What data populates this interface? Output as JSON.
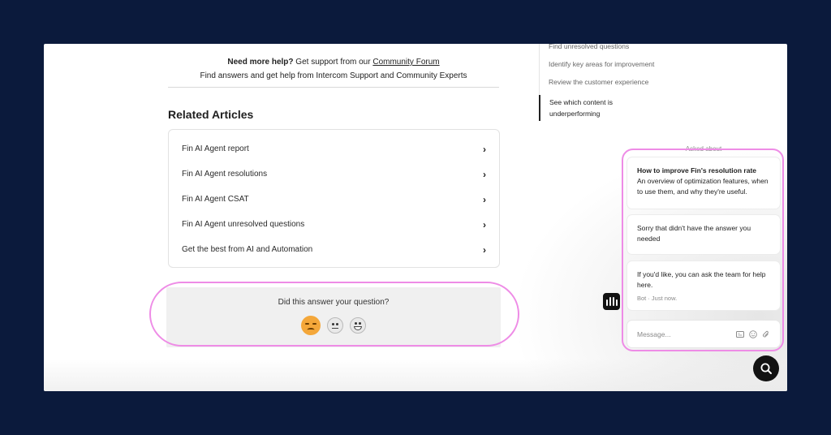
{
  "help": {
    "bold": "Need more help?",
    "text": " Get support from our ",
    "link": "Community Forum",
    "subtext": "Find answers and get help from Intercom Support and Community Experts"
  },
  "related": {
    "heading": "Related Articles",
    "articles": [
      {
        "label": "Fin AI Agent report",
        "icon": "chevron-right-icon"
      },
      {
        "label": "Fin AI Agent resolutions",
        "icon": "chevron-right-icon"
      },
      {
        "label": "Fin AI Agent CSAT",
        "icon": "chevron-right-icon"
      },
      {
        "label": "Fin AI Agent unresolved questions",
        "icon": "chevron-right-icon"
      },
      {
        "label": "Get the best from AI and Automation",
        "icon": "chevron-right-icon"
      }
    ]
  },
  "feedback": {
    "question": "Did this answer your question?",
    "reactions": [
      "sad-face-icon",
      "neutral-face-icon",
      "smiley-face-icon"
    ]
  },
  "toc": {
    "items": [
      "Find unresolved questions",
      "Identify key areas for improvement",
      "Review the customer experience",
      "See which content is underperforming"
    ],
    "active_index": 3
  },
  "chat": {
    "asked_about": "Asked about",
    "article_title": "How to improve Fin's resolution rate",
    "article_desc": "An overview of optimization features, when to use them, and why they're useful.",
    "message_1": "Sorry that didn't have the answer you needed",
    "message_2": "If you'd like, you can ask the team for help here.",
    "message_2_meta": "Bot · Just now.",
    "composer_placeholder": "Message..."
  },
  "colors": {
    "background": "#0b1a3c",
    "highlight": "#ee8ce6",
    "sad_emoji": "#f4a73a"
  }
}
